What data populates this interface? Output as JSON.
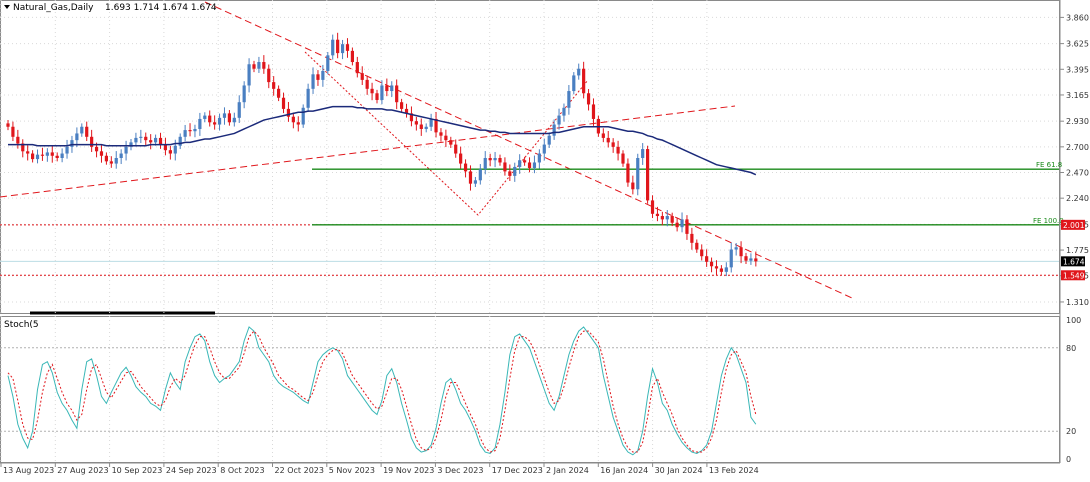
{
  "header": {
    "symbol": "Natural_Gas,Daily",
    "ohlc": "1.693 1.714 1.674 1.674"
  },
  "subwindow_label": "Stoch(5",
  "colors": {
    "bull_candle": "#4a7fc1",
    "bear_candle": "#e0161b",
    "moving_average": "#1b2a7a",
    "trendline": "#e0161b",
    "fib_line": "#1a8a1a",
    "stoch_main": "#3ab7b7",
    "stoch_signal": "#e0161b",
    "grid": "#d9d9d9",
    "axis_text": "#333333"
  },
  "chart_data": [
    {
      "type": "candlestick",
      "series": [
        {
          "name": "Natural_Gas,Daily",
          "close": [
            2.88,
            2.79,
            2.73,
            2.66,
            2.64,
            2.59,
            2.63,
            2.62,
            2.65,
            2.62,
            2.6,
            2.64,
            2.7,
            2.76,
            2.82,
            2.88,
            2.79,
            2.7,
            2.66,
            2.62,
            2.57,
            2.55,
            2.6,
            2.64,
            2.7,
            2.74,
            2.78,
            2.79,
            2.76,
            2.74,
            2.78,
            2.72,
            2.67,
            2.64,
            2.71,
            2.79,
            2.85,
            2.84,
            2.86,
            2.95,
            2.98,
            2.92,
            2.9,
            2.96,
            3.0,
            2.92,
            2.96,
            3.1,
            3.25,
            3.44,
            3.4,
            3.46,
            3.4,
            3.28,
            3.22,
            3.14,
            3.04,
            2.97,
            2.92,
            2.9,
            3.05,
            3.22,
            3.35,
            3.3,
            3.38,
            3.52,
            3.66,
            3.54,
            3.62,
            3.56,
            3.46,
            3.36,
            3.3,
            3.22,
            3.18,
            3.12,
            3.25,
            3.2,
            3.25,
            3.1,
            3.04,
            3.0,
            2.93,
            2.9,
            2.86,
            2.88,
            2.95,
            2.83,
            2.8,
            2.76,
            2.72,
            2.64,
            2.55,
            2.48,
            2.37,
            2.4,
            2.5,
            2.6,
            2.58,
            2.6,
            2.56,
            2.48,
            2.44,
            2.52,
            2.58,
            2.56,
            2.51,
            2.56,
            2.64,
            2.72,
            2.8,
            2.9,
            2.98,
            3.05,
            3.2,
            3.34,
            3.4,
            3.18,
            3.08,
            2.95,
            2.82,
            2.78,
            2.74,
            2.7,
            2.64,
            2.55,
            2.38,
            2.32,
            2.6,
            2.68,
            2.22,
            2.1,
            2.08,
            2.05,
            2.08,
            2.02,
            1.98,
            2.05,
            1.92,
            1.84,
            1.78,
            1.72,
            1.67,
            1.63,
            1.61,
            1.58,
            1.62,
            1.78,
            1.8,
            1.72,
            1.68,
            1.7,
            1.674
          ]
        },
        {
          "name": "Moving Average",
          "values": [
            2.72,
            2.72,
            2.72,
            2.72,
            2.72,
            2.72,
            2.71,
            2.71,
            2.71,
            2.71,
            2.71,
            2.71,
            2.71,
            2.72,
            2.72,
            2.72,
            2.72,
            2.72,
            2.72,
            2.72,
            2.71,
            2.71,
            2.71,
            2.71,
            2.71,
            2.71,
            2.71,
            2.71,
            2.71,
            2.72,
            2.72,
            2.72,
            2.72,
            2.72,
            2.73,
            2.73,
            2.74,
            2.74,
            2.75,
            2.76,
            2.77,
            2.77,
            2.78,
            2.79,
            2.8,
            2.81,
            2.82,
            2.84,
            2.86,
            2.88,
            2.9,
            2.92,
            2.94,
            2.95,
            2.96,
            2.97,
            2.98,
            2.99,
            3.0,
            3.01,
            3.01,
            3.02,
            3.02,
            3.03,
            3.04,
            3.05,
            3.06,
            3.06,
            3.06,
            3.06,
            3.06,
            3.05,
            3.05,
            3.04,
            3.04,
            3.04,
            3.04,
            3.03,
            3.03,
            3.02,
            3.01,
            3.0,
            2.99,
            2.98,
            2.97,
            2.96,
            2.95,
            2.94,
            2.93,
            2.92,
            2.91,
            2.9,
            2.89,
            2.88,
            2.87,
            2.86,
            2.85,
            2.85,
            2.84,
            2.84,
            2.83,
            2.83,
            2.82,
            2.82,
            2.82,
            2.82,
            2.82,
            2.82,
            2.82,
            2.82,
            2.82,
            2.83,
            2.83,
            2.84,
            2.85,
            2.86,
            2.87,
            2.88,
            2.88,
            2.88,
            2.88,
            2.88,
            2.88,
            2.87,
            2.86,
            2.85,
            2.84,
            2.84,
            2.83,
            2.82,
            2.8,
            2.79,
            2.77,
            2.76,
            2.74,
            2.72,
            2.7,
            2.68,
            2.66,
            2.64,
            2.62,
            2.6,
            2.58,
            2.56,
            2.54,
            2.53,
            2.52,
            2.51,
            2.5,
            2.49,
            2.48,
            2.47,
            2.45
          ]
        },
        {
          "name": "FE 61.8",
          "values": [
            2.5
          ]
        },
        {
          "name": "FE 100.0",
          "values": [
            2.001
          ]
        }
      ],
      "price_labels": {
        "current": "1.674",
        "fe100": "2.001",
        "support": "1.549"
      },
      "y_ticks": [
        "3.860",
        "3.625",
        "3.395",
        "3.165",
        "2.930",
        "2.700",
        "2.470",
        "2.240",
        "2.005",
        "1.775",
        "1.545",
        "1.310"
      ],
      "ylim": [
        1.22,
        3.98
      ],
      "x_ticks": [
        "13 Aug 2023",
        "27 Aug 2023",
        "10 Sep 2023",
        "24 Sep 2023",
        "8 Oct 2023",
        "22 Oct 2023",
        "5 Nov 2023",
        "19 Nov 2023",
        "3 Dec 2023",
        "17 Dec 2023",
        "2 Jan 2024",
        "16 Jan 2024",
        "30 Jan 2024",
        "13 Feb 2024"
      ],
      "annotations": [
        "FE 61.8",
        "FE 100.0"
      ]
    },
    {
      "type": "line",
      "series": [
        {
          "name": "Stoch(5",
          "values": [
            60,
            45,
            25,
            15,
            8,
            20,
            50,
            68,
            70,
            62,
            48,
            40,
            35,
            28,
            22,
            50,
            70,
            72,
            60,
            45,
            40,
            48,
            55,
            62,
            66,
            60,
            52,
            48,
            45,
            40,
            38,
            35,
            50,
            62,
            55,
            50,
            70,
            80,
            88,
            90,
            85,
            70,
            60,
            55,
            58,
            60,
            65,
            70,
            85,
            95,
            92,
            80,
            75,
            70,
            60,
            55,
            52,
            50,
            48,
            45,
            42,
            40,
            55,
            70,
            75,
            78,
            80,
            78,
            72,
            60,
            55,
            50,
            45,
            40,
            35,
            32,
            42,
            60,
            65,
            55,
            40,
            28,
            15,
            8,
            5,
            6,
            10,
            22,
            40,
            55,
            58,
            50,
            40,
            35,
            28,
            20,
            10,
            5,
            4,
            8,
            25,
            48,
            75,
            88,
            90,
            85,
            80,
            70,
            60,
            50,
            40,
            35,
            45,
            60,
            75,
            85,
            92,
            95,
            90,
            85,
            80,
            60,
            45,
            30,
            20,
            10,
            5,
            3,
            6,
            20,
            45,
            65,
            55,
            40,
            35,
            25,
            18,
            12,
            8,
            5,
            4,
            6,
            10,
            20,
            40,
            60,
            72,
            80,
            75,
            65,
            55,
            30,
            25
          ]
        },
        {
          "name": "Signal",
          "values": [
            62,
            58,
            42,
            25,
            15,
            14,
            28,
            48,
            62,
            68,
            58,
            48,
            40,
            35,
            28,
            32,
            50,
            65,
            68,
            58,
            48,
            44,
            50,
            56,
            62,
            63,
            58,
            52,
            48,
            44,
            40,
            38,
            42,
            52,
            58,
            55,
            60,
            72,
            82,
            88,
            88,
            80,
            70,
            62,
            58,
            58,
            62,
            66,
            76,
            88,
            92,
            88,
            80,
            74,
            68,
            60,
            56,
            52,
            50,
            47,
            44,
            42,
            48,
            60,
            70,
            75,
            78,
            79,
            76,
            68,
            60,
            55,
            50,
            45,
            40,
            36,
            38,
            48,
            58,
            58,
            50,
            38,
            25,
            14,
            8,
            6,
            8,
            15,
            28,
            45,
            55,
            55,
            48,
            40,
            32,
            25,
            15,
            8,
            5,
            6,
            15,
            35,
            58,
            78,
            88,
            88,
            85,
            78,
            68,
            58,
            48,
            40,
            42,
            52,
            66,
            78,
            88,
            92,
            92,
            88,
            84,
            72,
            55,
            38,
            25,
            15,
            8,
            5,
            5,
            12,
            30,
            52,
            58,
            48,
            40,
            32,
            22,
            15,
            10,
            6,
            5,
            5,
            8,
            15,
            28,
            48,
            65,
            75,
            78,
            70,
            62,
            45,
            32
          ]
        }
      ],
      "y_ticks": [
        "100",
        "80",
        "20",
        "0"
      ],
      "ylim": [
        0,
        100
      ]
    }
  ]
}
